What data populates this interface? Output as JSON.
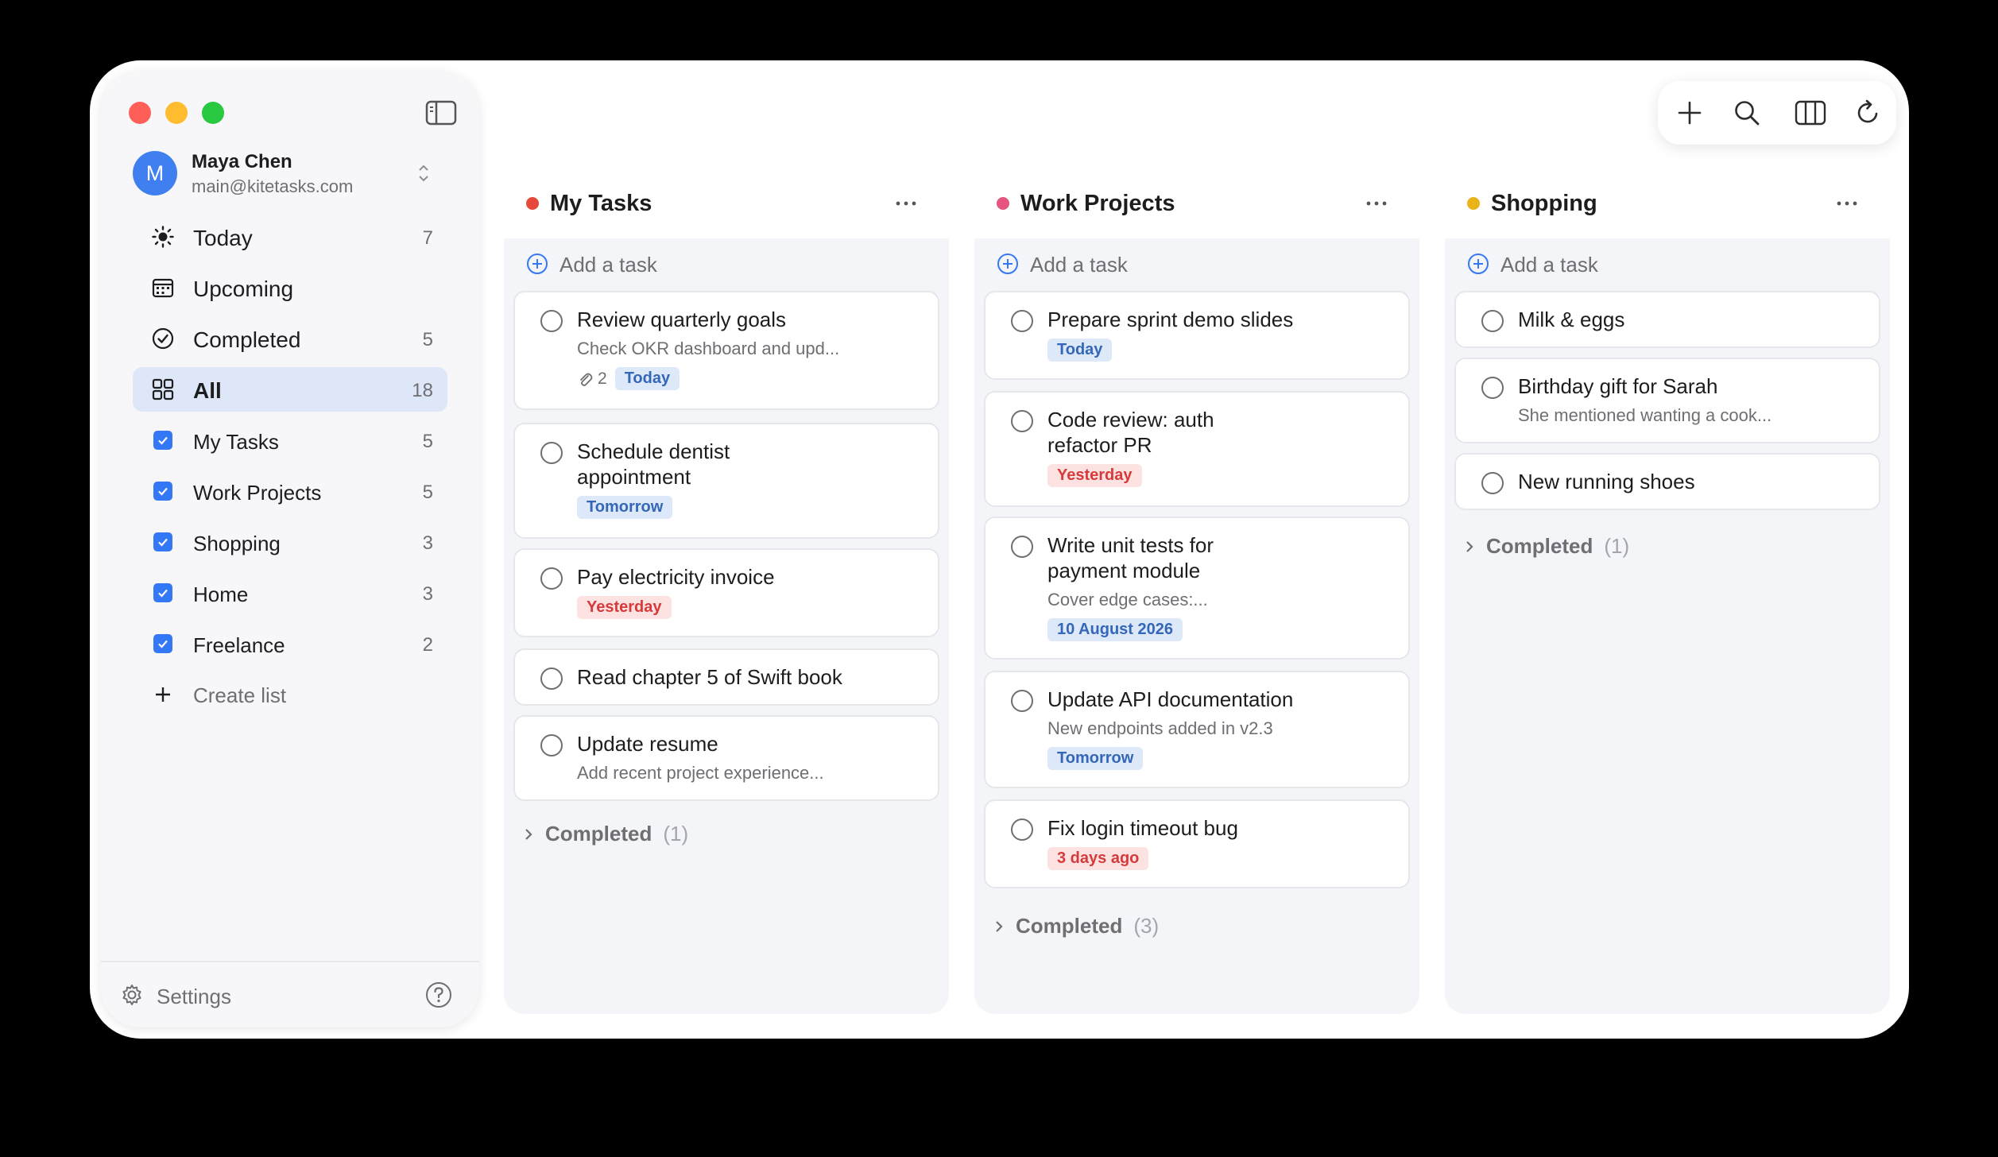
{
  "account": {
    "initial": "M",
    "name": "Maya Chen",
    "email": "main@kitetasks.com"
  },
  "nav": [
    {
      "label": "Today",
      "count": "7",
      "icon": "sun-icon"
    },
    {
      "label": "Upcoming",
      "count": "",
      "icon": "calendar-icon"
    },
    {
      "label": "Completed",
      "count": "5",
      "icon": "check-circle-icon"
    },
    {
      "label": "All",
      "count": "18",
      "icon": "grid-icon"
    }
  ],
  "lists": [
    {
      "label": "My Tasks",
      "count": "5"
    },
    {
      "label": "Work Projects",
      "count": "5"
    },
    {
      "label": "Shopping",
      "count": "3"
    },
    {
      "label": "Home",
      "count": "3"
    },
    {
      "label": "Freelance",
      "count": "2"
    }
  ],
  "create_list": "Create list",
  "settings": "Settings",
  "add_task": "Add a task",
  "completed_label": "Completed",
  "colors": {
    "accent": "#3478f6",
    "my_tasks": "#e5493a",
    "work_projects": "#e5557f",
    "shopping": "#e8b41a"
  },
  "columns": [
    {
      "title": "My Tasks",
      "tasks": [
        {
          "title": "Review quarterly goals",
          "note": "Check OKR dashboard and upd...",
          "attachments": "2",
          "tag": "Today"
        },
        {
          "title": "Schedule dentist appointment",
          "tag": "Tomorrow"
        },
        {
          "title": "Pay electricity invoice",
          "tag": "Yesterday"
        },
        {
          "title": "Read chapter 5 of Swift book"
        },
        {
          "title": "Update resume",
          "note": "Add recent project experience..."
        }
      ],
      "completed_count": "(1)"
    },
    {
      "title": "Work Projects",
      "tasks": [
        {
          "title": "Prepare sprint demo slides",
          "tag": "Today"
        },
        {
          "title": "Code review: auth refactor PR",
          "tag": "Yesterday"
        },
        {
          "title": "Write unit tests for payment module",
          "note": "Cover edge cases:...",
          "tag": "10 August 2026"
        },
        {
          "title": "Update API documentation",
          "note": "New endpoints added in v2.3",
          "tag": "Tomorrow"
        },
        {
          "title": "Fix login timeout bug",
          "tag": "3 days ago"
        }
      ],
      "completed_count": "(3)"
    },
    {
      "title": "Shopping",
      "tasks": [
        {
          "title": "Milk & eggs"
        },
        {
          "title": "Birthday gift for Sarah",
          "note": "She mentioned wanting a cook..."
        },
        {
          "title": "New running shoes"
        }
      ],
      "completed_count": "(1)"
    }
  ]
}
